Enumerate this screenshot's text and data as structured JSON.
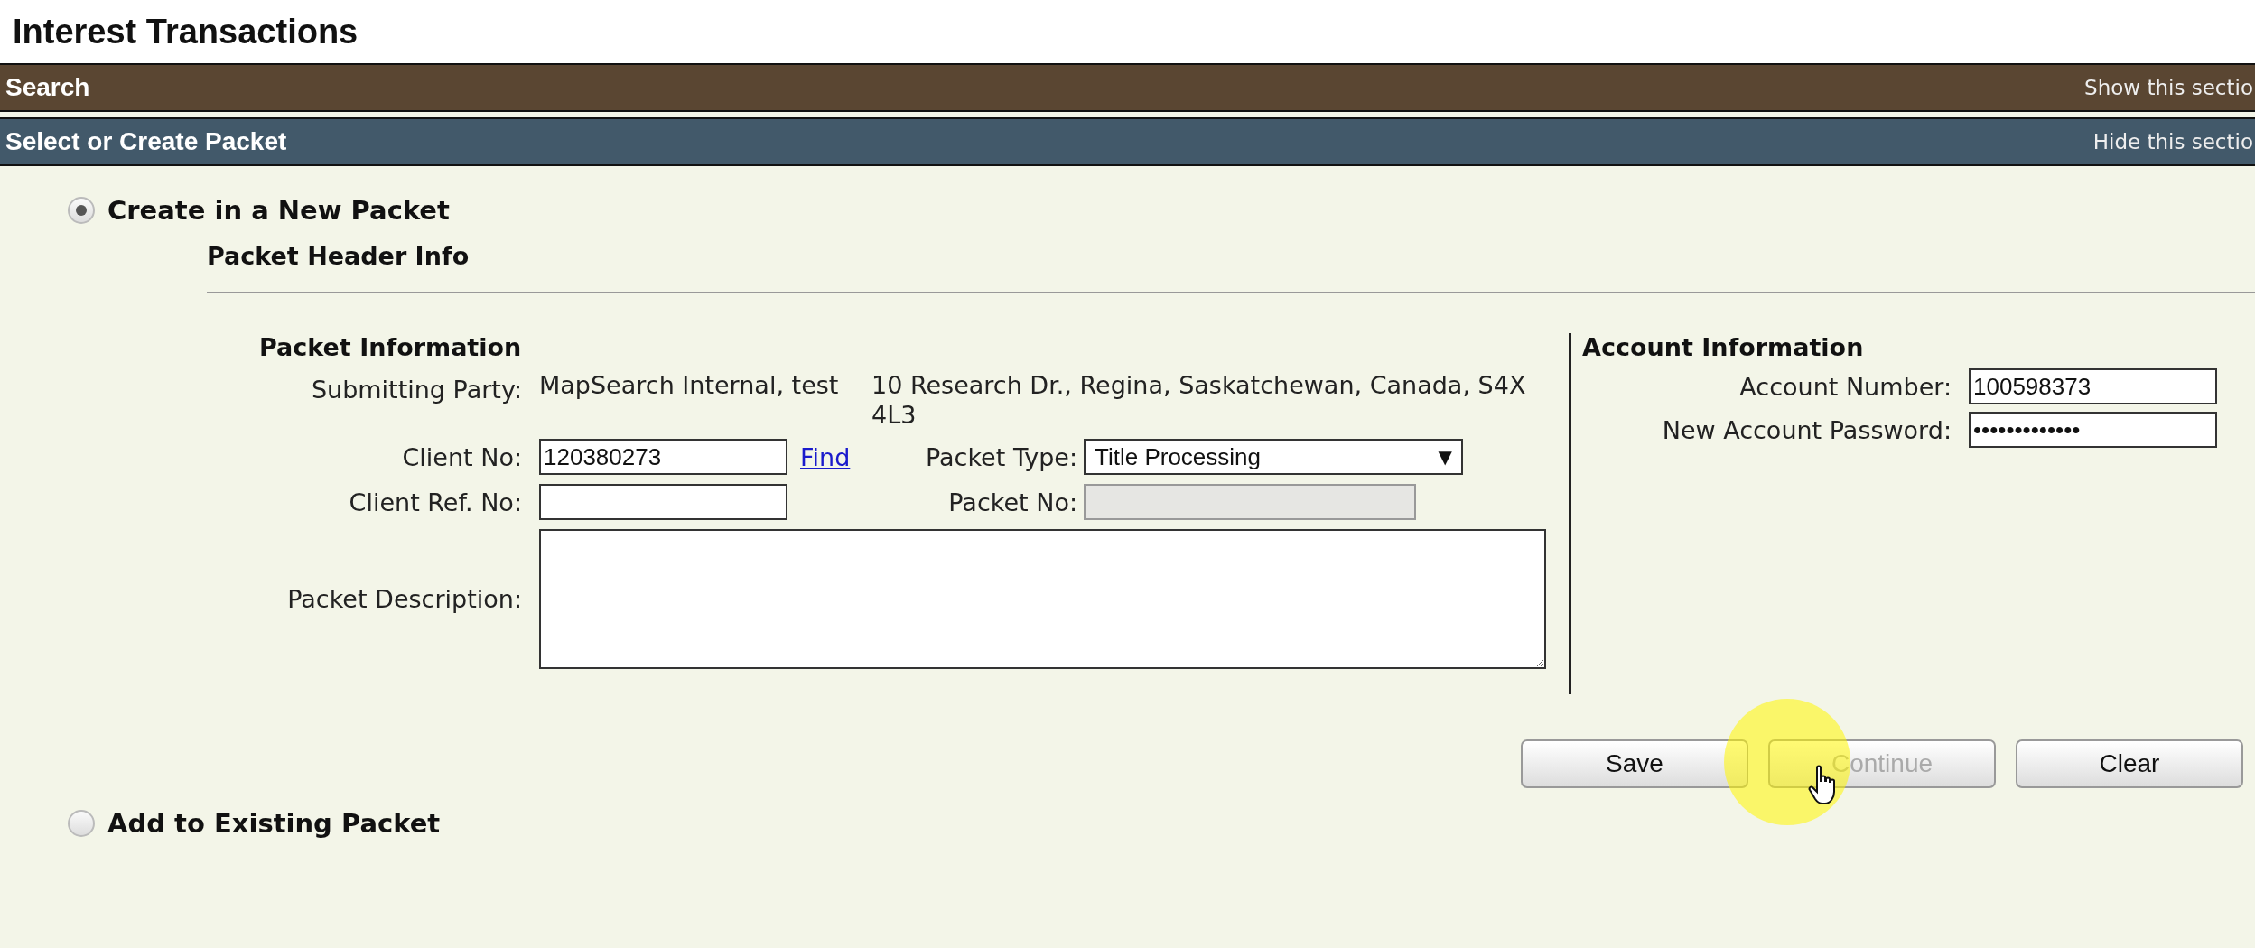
{
  "page": {
    "title": "Interest Transactions"
  },
  "sections": [
    {
      "title": "Search",
      "toggle": "Show this sectio",
      "expanded": false
    },
    {
      "title": "Select or Create Packet",
      "toggle": "Hide this sectio",
      "expanded": true
    }
  ],
  "options": [
    {
      "label": "Create in a New Packet",
      "selected": true
    },
    {
      "label": "Add to Existing Packet",
      "selected": false
    }
  ],
  "header_info": {
    "title": "Packet Header Info"
  },
  "packet_info": {
    "title": "Packet Information",
    "submitting_party": {
      "label": "Submitting Party:",
      "name": "MapSearch Internal, test",
      "address": "10 Research Dr., Regina, Saskatchewan, Canada, S4X 4L3"
    },
    "client_no": {
      "label": "Client No:",
      "value": "120380273",
      "link": "Find"
    },
    "packet_type": {
      "label": "Packet Type:",
      "value": "Title Processing",
      "arrow": "▼"
    },
    "client_ref": {
      "label": "Client Ref. No:"
    },
    "packet_no": {
      "label": "Packet No:",
      "disabled": true
    },
    "description": {
      "label": "Packet Description:"
    }
  },
  "account_info": {
    "title": "Account Information",
    "fields": [
      {
        "label": "Account Number:",
        "value": "100598373"
      },
      {
        "label": "New Account Password:",
        "value": "•••••••••••••"
      }
    ]
  },
  "buttons": [
    {
      "label": "Save",
      "disabled": false
    },
    {
      "label": "Continue",
      "disabled": true
    },
    {
      "label": "Clear",
      "disabled": false
    }
  ]
}
